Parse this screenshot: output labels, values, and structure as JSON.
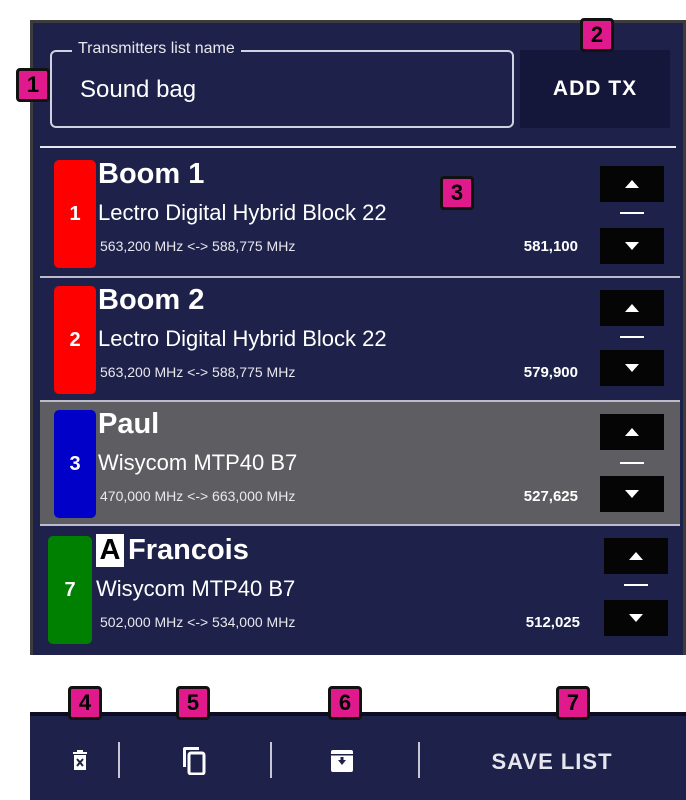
{
  "header": {
    "list_name_label": "Transmitters list name",
    "list_name_value": "Sound bag",
    "add_button": "ADD TX"
  },
  "transmitters": [
    {
      "number": "1",
      "name": "Boom 1",
      "model": "Lectro Digital Hybrid Block 22",
      "range": "563,200 MHz <-> 588,775 MHz",
      "frequency": "581,100",
      "color": "#ff0000"
    },
    {
      "number": "2",
      "name": "Boom 2",
      "model": "Lectro Digital Hybrid Block 22",
      "range": "563,200 MHz <-> 588,775 MHz",
      "frequency": "579,900",
      "color": "#ff0000"
    },
    {
      "number": "3",
      "name": "Paul",
      "model": "Wisycom MTP40 B7",
      "range": "470,000 MHz <-> 663,000 MHz",
      "frequency": "527,625",
      "color": "#0000c8",
      "selected": true
    },
    {
      "number": "7",
      "badge": "A",
      "name": "Francois",
      "model": "Wisycom MTP40 B7",
      "range": "502,000 MHz <-> 534,000 MHz",
      "frequency": "512,025",
      "color": "#008000"
    }
  ],
  "toolbar": {
    "delete_icon": "delete-icon",
    "copy_icon": "copy-icon",
    "archive_icon": "archive-icon",
    "save_label": "SAVE LIST"
  },
  "markers": [
    "1",
    "2",
    "3",
    "4",
    "5",
    "6",
    "7"
  ]
}
